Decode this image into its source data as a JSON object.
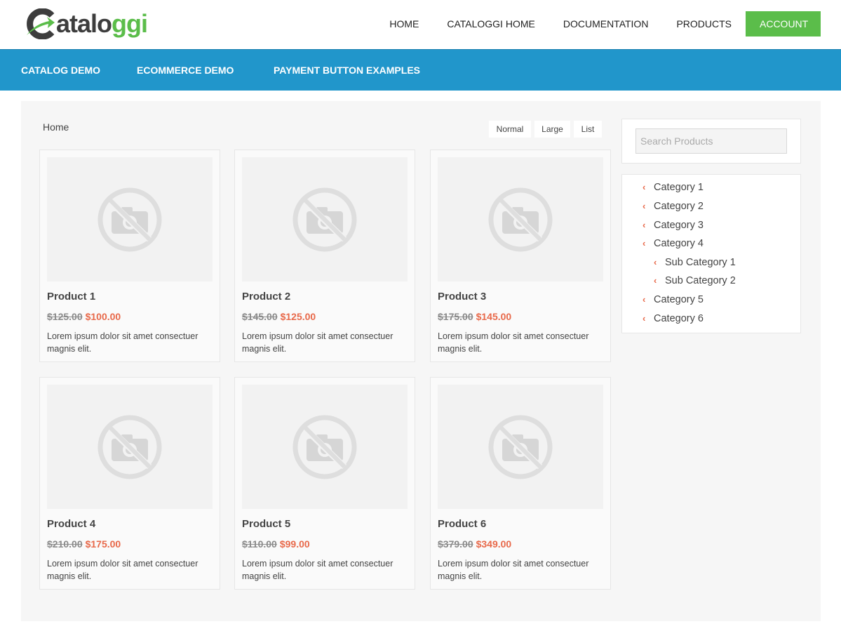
{
  "header": {
    "logo": {
      "prefix": "C",
      "dark": "atalo",
      "green": "ggi"
    },
    "nav": [
      "HOME",
      "CATALOGGI HOME",
      "DOCUMENTATION",
      "PRODUCTS"
    ],
    "account_label": "ACCOUNT"
  },
  "subnav": [
    "CATALOG DEMO",
    "ECOMMERCE DEMO",
    "PAYMENT BUTTON EXAMPLES"
  ],
  "breadcrumb": "Home",
  "view_options": [
    "Normal",
    "Large",
    "List"
  ],
  "products": [
    {
      "name": "Product 1",
      "old_price": "$125.00",
      "price": "$100.00",
      "description": "Lorem ipsum dolor sit amet consectuer magnis elit."
    },
    {
      "name": "Product 2",
      "old_price": "$145.00",
      "price": "$125.00",
      "description": "Lorem ipsum dolor sit amet consectuer magnis elit."
    },
    {
      "name": "Product 3",
      "old_price": "$175.00",
      "price": "$145.00",
      "description": "Lorem ipsum dolor sit amet consectuer magnis elit."
    },
    {
      "name": "Product 4",
      "old_price": "$210.00",
      "price": "$175.00",
      "description": "Lorem ipsum dolor sit amet consectuer magnis elit."
    },
    {
      "name": "Product 5",
      "old_price": "$110.00",
      "price": "$99.00",
      "description": "Lorem ipsum dolor sit amet consectuer magnis elit."
    },
    {
      "name": "Product 6",
      "old_price": "$379.00",
      "price": "$349.00",
      "description": "Lorem ipsum dolor sit amet consectuer magnis elit."
    }
  ],
  "search": {
    "placeholder": "Search Products"
  },
  "categories": [
    {
      "label": "Category 1",
      "level": 0
    },
    {
      "label": "Category 2",
      "level": 0
    },
    {
      "label": "Category 3",
      "level": 0
    },
    {
      "label": "Category 4",
      "level": 0
    },
    {
      "label": "Sub Category 1",
      "level": 1
    },
    {
      "label": "Sub Category 2",
      "level": 1
    },
    {
      "label": "Category 5",
      "level": 0
    },
    {
      "label": "Category 6",
      "level": 0
    }
  ],
  "icons": {
    "placeholder_image": "no-camera-icon",
    "category_bullet": "chevron-left-icon"
  },
  "colors": {
    "brand_green": "#5bbd4a",
    "brand_blue": "#2196cb",
    "sale_price": "#e8694a"
  }
}
